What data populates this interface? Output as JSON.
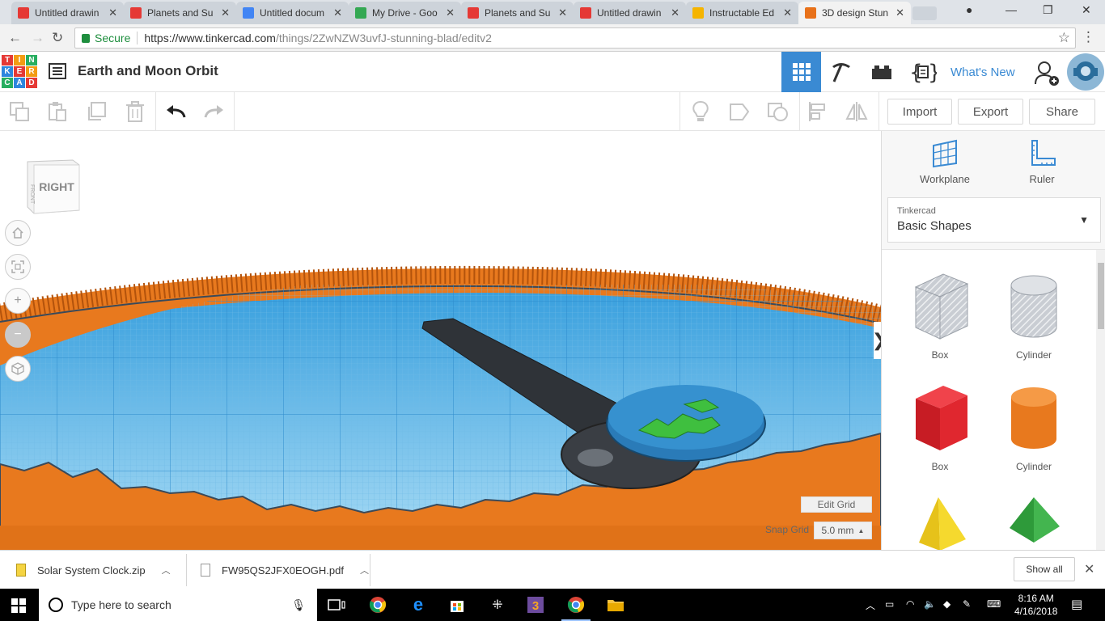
{
  "browser": {
    "tabs": [
      {
        "title": "Untitled drawin",
        "favicon_color": "#e53935",
        "active": false
      },
      {
        "title": "Planets and Su",
        "favicon_color": "#e53935",
        "active": false
      },
      {
        "title": "Untitled docum",
        "favicon_color": "#4285f4",
        "active": false
      },
      {
        "title": "My Drive - Goo",
        "favicon_color": "#34a853",
        "active": false
      },
      {
        "title": "Planets and Su",
        "favicon_color": "#e53935",
        "active": false
      },
      {
        "title": "Untitled drawin",
        "favicon_color": "#e53935",
        "active": false
      },
      {
        "title": "Instructable Ed",
        "favicon_color": "#f5b400",
        "active": false
      },
      {
        "title": "3D design Stun",
        "favicon_color": "#e8711a",
        "active": true
      }
    ],
    "secure_label": "Secure",
    "url_host": "https://www.tinkercad.com",
    "url_path": "/things/2ZwNZW3uvfJ-stunning-blad/editv2"
  },
  "app": {
    "logo_letters": [
      "TIN",
      "KER",
      "CAD"
    ],
    "logo_colors": [
      "#e53935",
      "#f39c12",
      "#27ae60",
      "#2e86de",
      "#e53935",
      "#f39c12",
      "#27ae60",
      "#2e86de",
      "#e53935"
    ],
    "doc_title": "Earth and Moon Orbit",
    "whats_new": "What's New",
    "accent": "#3a8ad3"
  },
  "toolbar": {
    "import_label": "Import",
    "export_label": "Export",
    "share_label": "Share"
  },
  "viewport": {
    "cube_face": "RIGHT",
    "cube_side": "FRONT",
    "edit_grid_label": "Edit Grid",
    "snap_grid_label": "Snap Grid",
    "snap_grid_value": "5.0 mm"
  },
  "panel": {
    "workplane_label": "Workplane",
    "ruler_label": "Ruler",
    "library_source": "Tinkercad",
    "library_name": "Basic Shapes",
    "shapes": [
      {
        "name": "Box",
        "color": "#b8bcc4"
      },
      {
        "name": "Cylinder",
        "color": "#b8bcc4"
      },
      {
        "name": "Box",
        "color": "#d7262e"
      },
      {
        "name": "Cylinder",
        "color": "#e8791e"
      }
    ]
  },
  "downloads": {
    "items": [
      "Solar System Clock.zip",
      "FW95QS2JFX0EOGH.pdf"
    ],
    "show_all_label": "Show all"
  },
  "taskbar": {
    "search_placeholder": "Type here to search",
    "time": "8:16 AM",
    "date": "4/16/2018"
  }
}
